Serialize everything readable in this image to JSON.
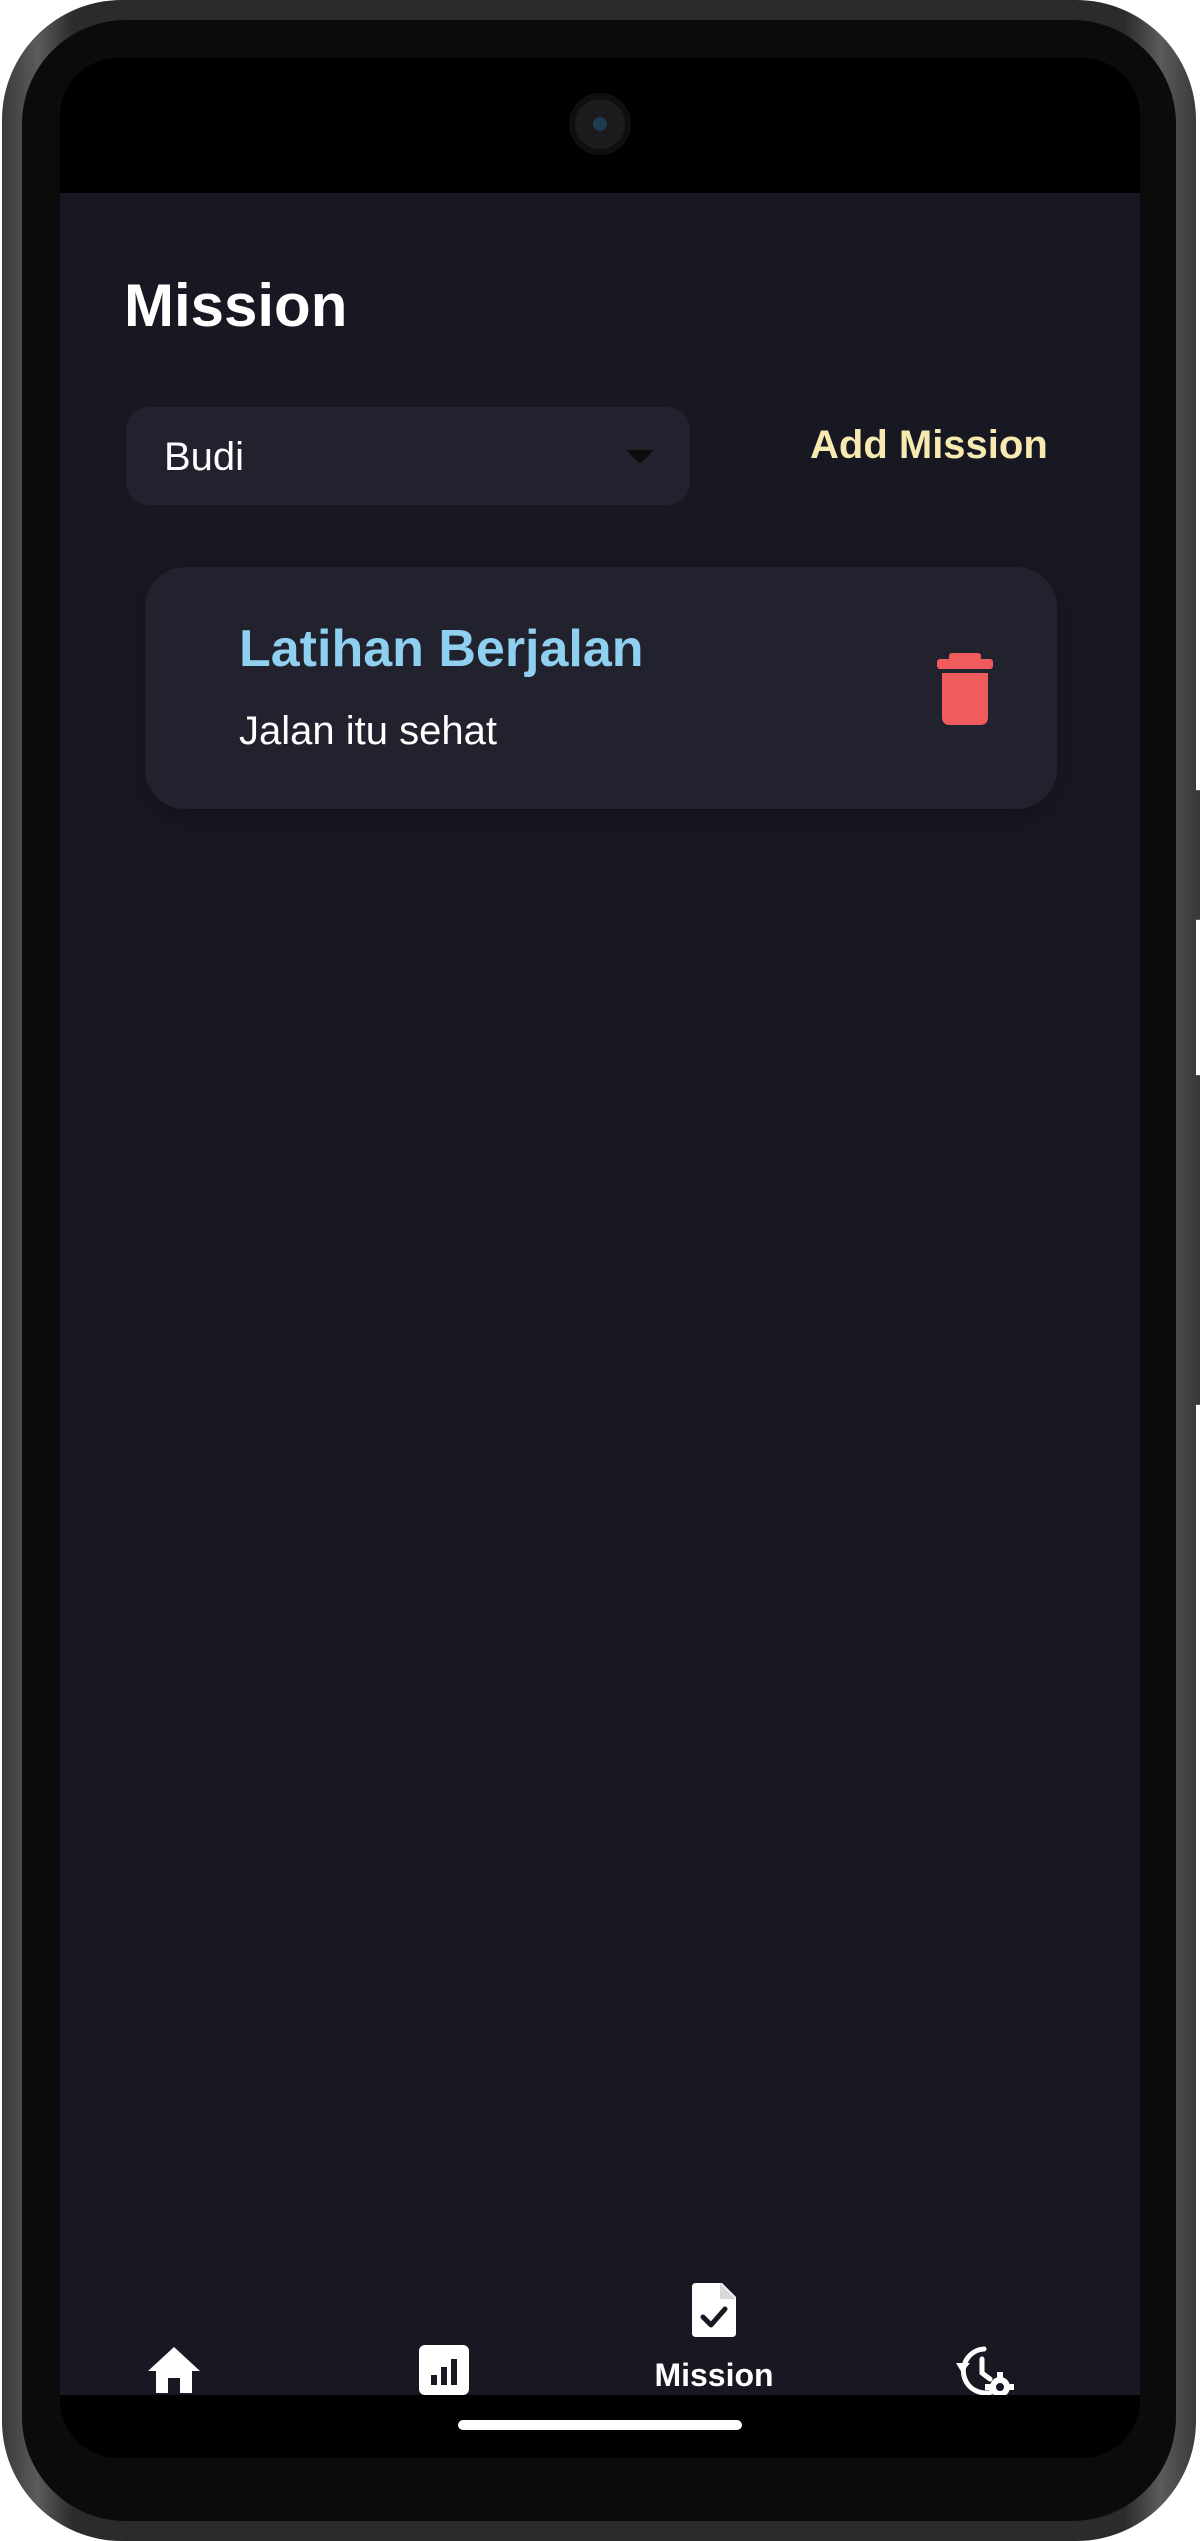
{
  "header": {
    "title": "Mission"
  },
  "user_select": {
    "selected": "Budi"
  },
  "actions": {
    "add_mission_label": "Add Mission"
  },
  "missions": [
    {
      "title": "Latihan Berjalan",
      "description": "Jalan itu sehat",
      "delete_icon": "trash-icon"
    }
  ],
  "bottom_nav": {
    "items": [
      {
        "icon": "home-icon",
        "label": ""
      },
      {
        "icon": "chart-icon",
        "label": ""
      },
      {
        "icon": "mission-check-icon",
        "label": "Mission",
        "active": true
      },
      {
        "icon": "history-settings-icon",
        "label": ""
      }
    ]
  },
  "colors": {
    "background": "#171821",
    "surface": "#21222d",
    "accent_title": "#8fd0f0",
    "add_mission": "#f7eab1",
    "delete": "#f05b5e",
    "text": "#ffffff"
  }
}
